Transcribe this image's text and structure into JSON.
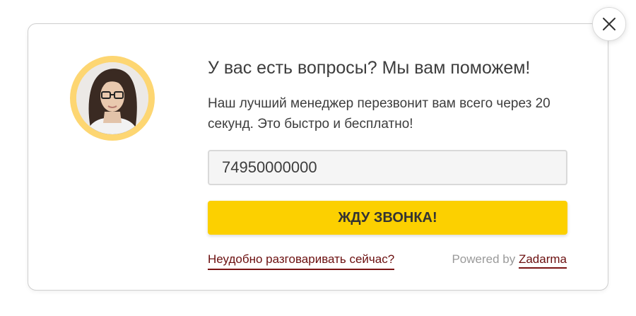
{
  "popup": {
    "title": "У вас есть вопросы? Мы вам поможем!",
    "description": "Наш лучший менеджер перезвонит вам всего через 20 секунд. Это быстро и бесплатно!",
    "phone_value": "74950000000",
    "call_button_label": "ЖДУ ЗВОНКА!",
    "later_link_label": "Неудобно разговаривать сейчас?",
    "powered_prefix": "Powered by",
    "powered_brand": "Zadarma",
    "close_icon": "close-icon",
    "avatar_icon": "manager-avatar"
  },
  "colors": {
    "accent_button": "#fcd000",
    "avatar_ring": "#fdd672",
    "link": "#6b0f0f",
    "text": "#3d3d3d",
    "muted": "#9a9a9a"
  }
}
